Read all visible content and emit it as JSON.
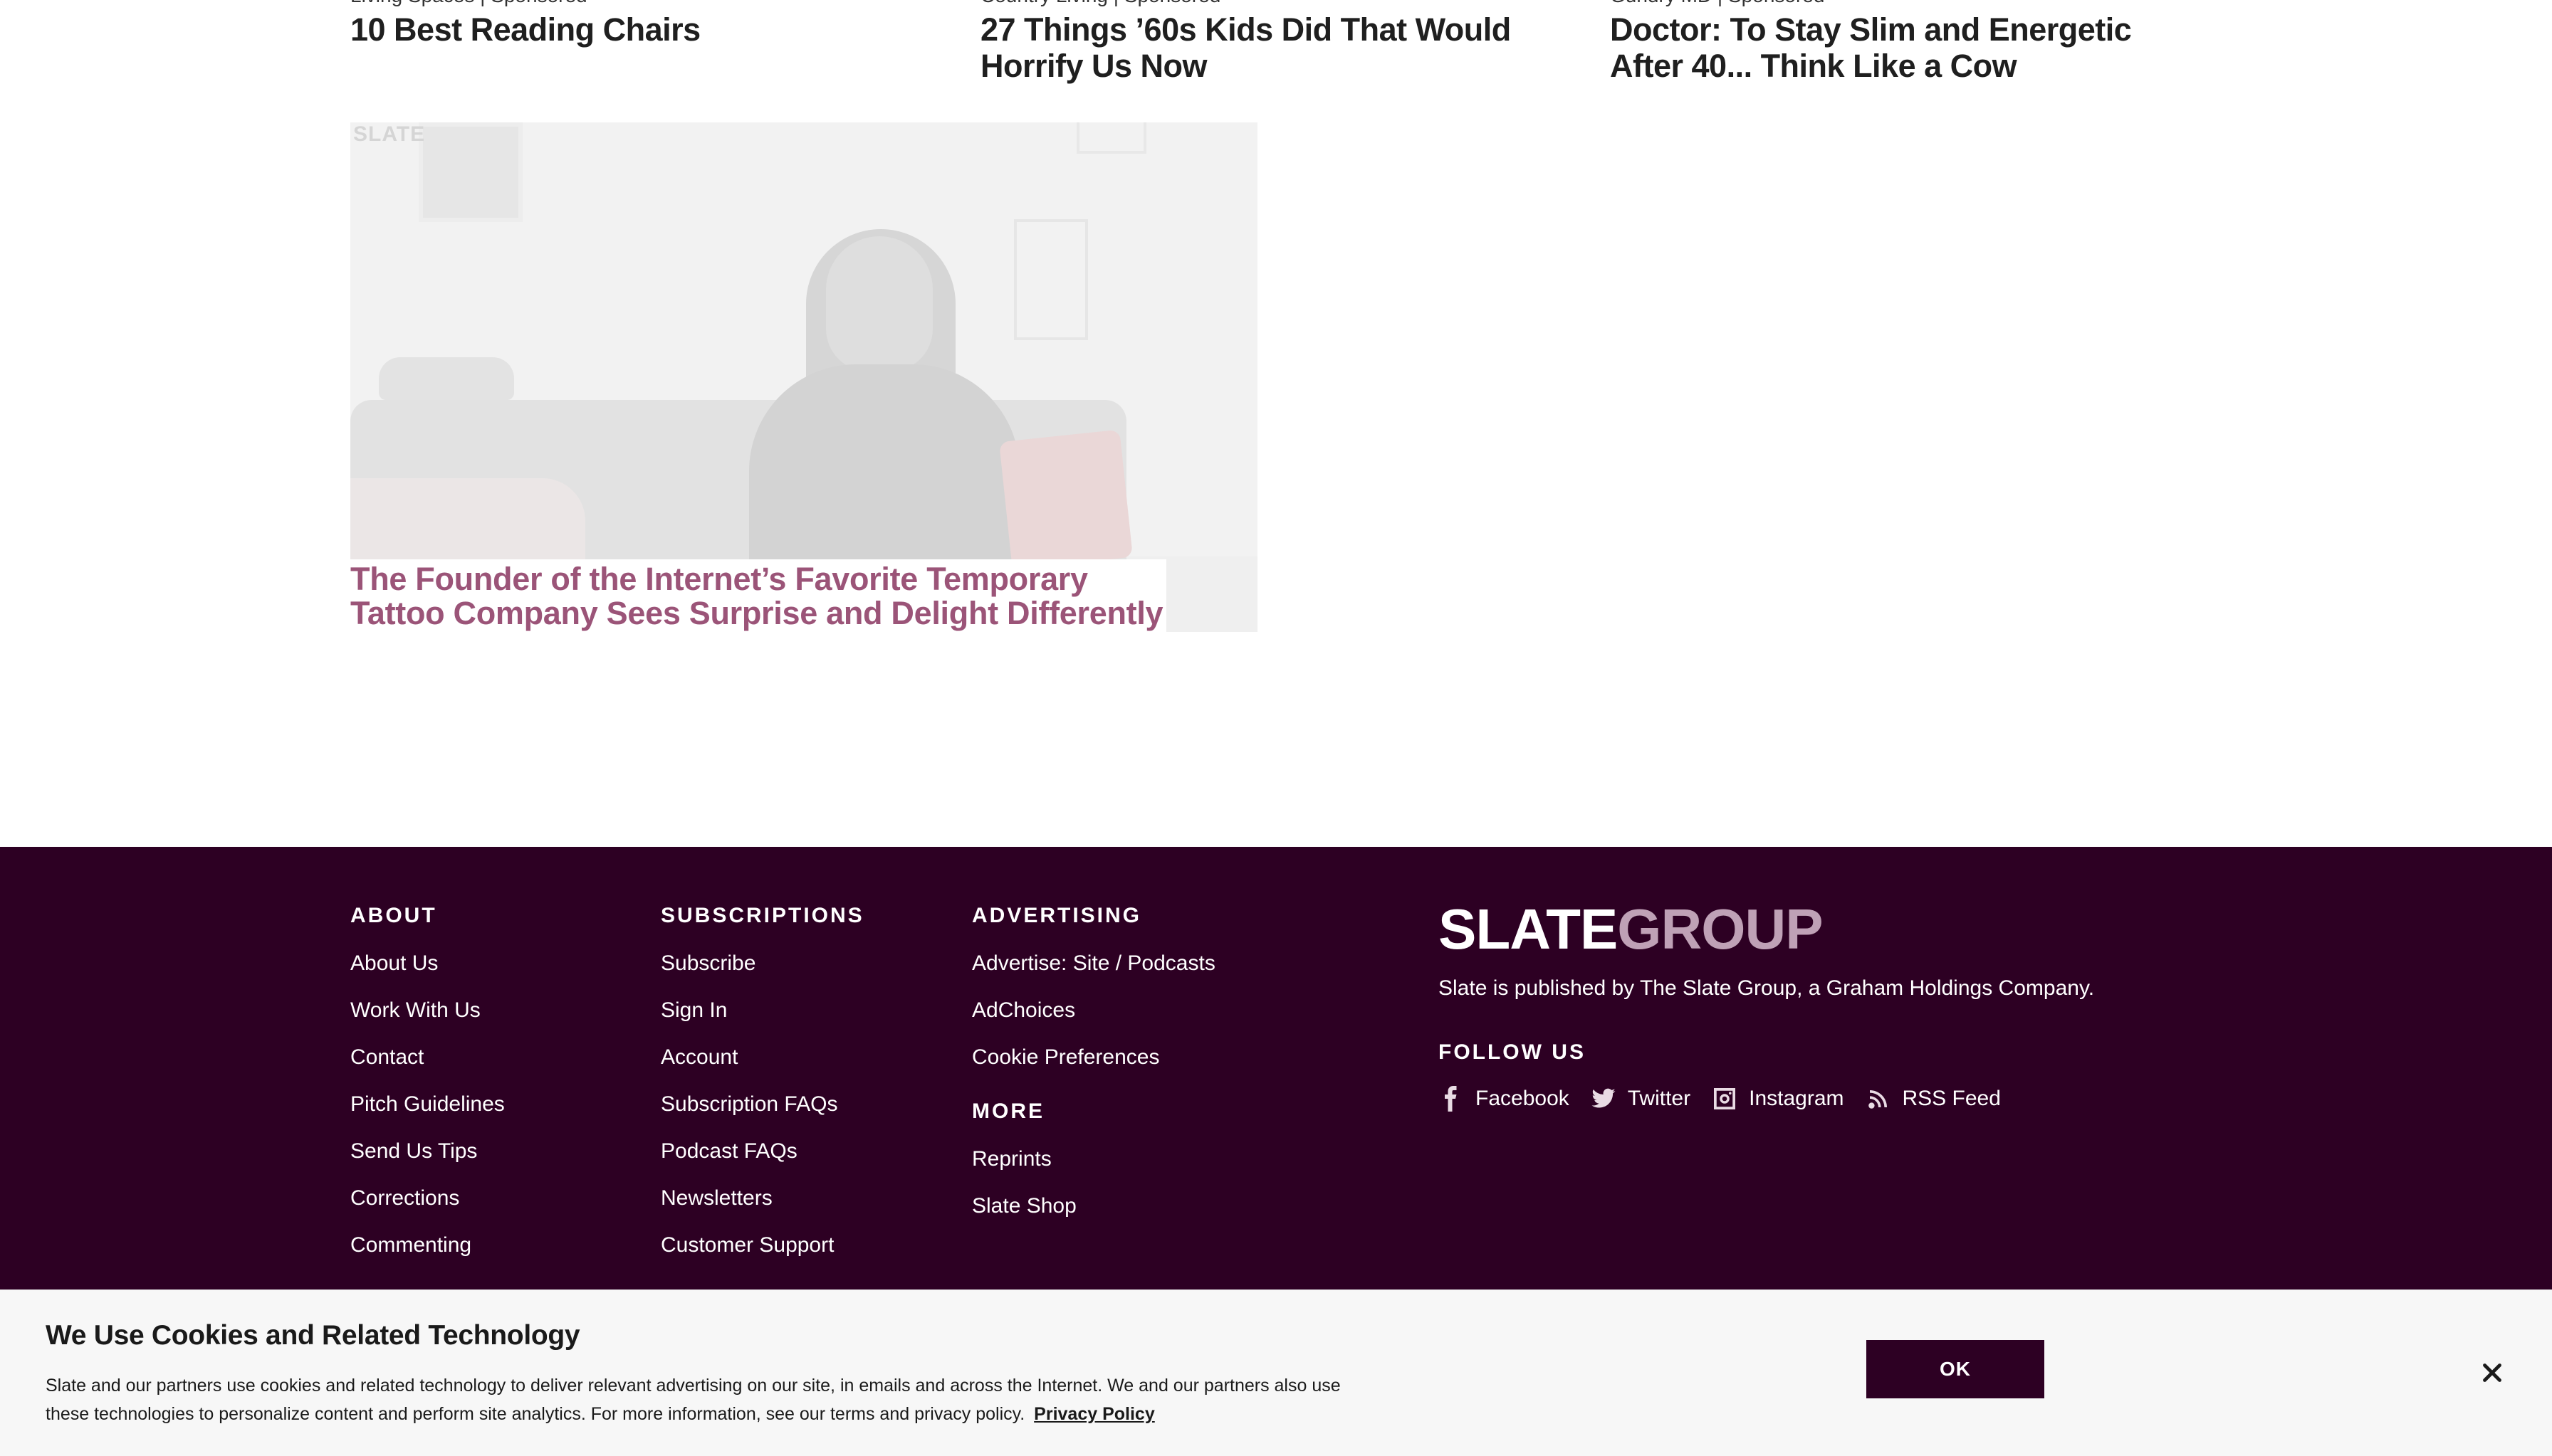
{
  "promos": [
    {
      "source": "Living Spaces",
      "tag": "Sponsored",
      "title": "10 Best Reading Chairs"
    },
    {
      "source": "Country Living",
      "tag": "Sponsored",
      "title": "27 Things ’60s Kids Did That Would Horrify Us Now"
    },
    {
      "source": "Gundry MD",
      "tag": "Sponsored",
      "title": "Doctor: To Stay Slim and Energetic After 40... Think Like a Cow"
    }
  ],
  "feature": {
    "watermark": "SLATE",
    "title": "The Founder of the Internet’s Favorite Temporary Tattoo Company Sees Surprise and Delight Differently"
  },
  "footer": {
    "about": {
      "heading": "ABOUT",
      "links": [
        "About Us",
        "Work With Us",
        "Contact",
        "Pitch Guidelines",
        "Send Us Tips",
        "Corrections",
        "Commenting"
      ]
    },
    "subscriptions": {
      "heading": "SUBSCRIPTIONS",
      "links": [
        "Subscribe",
        "Sign In",
        "Account",
        "Subscription FAQs",
        "Podcast FAQs",
        "Newsletters",
        "Customer Support"
      ]
    },
    "advertising": {
      "heading": "ADVERTISING",
      "links": [
        "Advertise: Site / Podcasts",
        "AdChoices",
        "Cookie Preferences"
      ]
    },
    "more": {
      "heading": "MORE",
      "links": [
        "Reprints",
        "Slate Shop"
      ]
    },
    "brand": {
      "logo_part1": "SLATE",
      "logo_part2": "GROUP",
      "published_by": "Slate is published by The Slate Group, a Graham Holdings Company.",
      "follow_heading": "FOLLOW US",
      "social": [
        {
          "label": "Facebook",
          "icon": "facebook-icon"
        },
        {
          "label": "Twitter",
          "icon": "twitter-icon"
        },
        {
          "label": "Instagram",
          "icon": "instagram-icon"
        },
        {
          "label": "RSS Feed",
          "icon": "rss-icon"
        }
      ]
    },
    "colors": {
      "background": "#2d0023",
      "logo_accent": "#bfa1b6"
    }
  },
  "cookie_banner": {
    "title": "We Use Cookies and Related Technology",
    "body_line1": "Slate and our partners use cookies and related technology to deliver relevant advertising on our site, in emails and across the Internet. We and our partners also use",
    "body_line2": "these technologies to personalize content and perform site analytics. For more information, see our terms and privacy policy.",
    "privacy_link": "Privacy Policy",
    "ok_label": "OK",
    "close_icon": "close-icon"
  }
}
